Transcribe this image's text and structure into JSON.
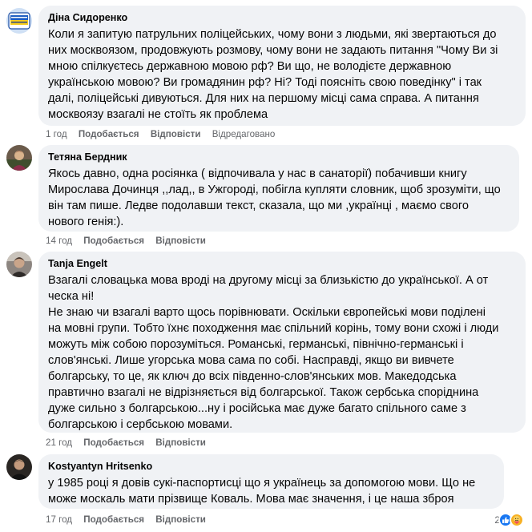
{
  "comments": [
    {
      "author": "Діна Сидоренко",
      "avatar_icon": "ukraine-badge-avatar",
      "avatar_badge_text": "РІДНА МОВА УКРАЇНСЬКА",
      "lines": [
        "Коли я запитую патрульних поліцейських, чому вони з людьми, які звертаються до",
        "них москвоязом, продовжують розмову, чому вони не задають питання \"Чому Ви зі",
        "мною спілкуєтесь державною мовою рф? Ви що, не володієте державною",
        "українською мовою? Ви громадянин рф? Ні? Тоді поясніть свою поведінку\" і так",
        "далі, поліцейські дивуються. Для них на першому місці сама справа. А питання",
        "москвоязу взагалі не стоїть як проблема"
      ],
      "time": "1 год",
      "like": "Подобається",
      "reply": "Відповісти",
      "edited": "Відредаговано"
    },
    {
      "author": "Тетяна Бердник",
      "avatar_icon": "person-photo-avatar",
      "lines": [
        "Якось давно, одна росіянка ( відпочивала у нас в санаторії) побачивши книгу",
        "Мирослава Дочинця ,,лад,, в Ужгороді, побігла купляти словник, щоб зрозуміти, що",
        "він там пише. Ледве подолавши текст, сказала, що ми ,українці , маємо свого",
        "нового генія:)."
      ],
      "time": "14 год",
      "like": "Подобається",
      "reply": "Відповісти"
    },
    {
      "author": "Tanja Engelt",
      "avatar_icon": "person-photo-avatar",
      "lines": [
        "Взагалі словацька мова вроді на другому місці за близькістю до української. А от",
        "ческа ні!",
        "Не знаю чи взагалі варто щось порівнювати. Оскільки європейські мови поділені",
        "на мовні групи. Тобто їхнє походження має спільний корінь, тому вони схожі і люди",
        "можуть між собою порозуміться. Романські, германські, північно-германські і",
        "слов'янські. Лише угорська мова сама по собі. Насправді, якщо ви вивчете",
        "болгарську, то це, як ключ до всіх південно-слов'янських мов. Македодська",
        "правтично взагалі не відрізняється від болгарської. Також сербська споріднина",
        "дуже сильно з болгарською...ну і російська має дуже багато спільного саме з",
        "болгарською і сербською мовами."
      ],
      "time": "21 год",
      "like": "Подобається",
      "reply": "Відповісти"
    },
    {
      "author": "Kostyantyn Hritsenko",
      "avatar_icon": "person-photo-avatar",
      "lines": [
        "у 1985 році я довів сукі-паспортисці що я українець за допомогою мови. Що не",
        "може москаль мати прізвище Коваль. Мова має значення, і це наша зброя"
      ],
      "time": "17 год",
      "like": "Подобається",
      "reply": "Відповісти",
      "reactions": {
        "count": "2",
        "icons": [
          "like-icon",
          "care-icon"
        ]
      }
    }
  ],
  "colors": {
    "bubble": "#f0f2f5",
    "meta": "#65676b",
    "text": "#050505",
    "like_reaction": "#1877f2",
    "care_reaction": "#f7b125"
  }
}
